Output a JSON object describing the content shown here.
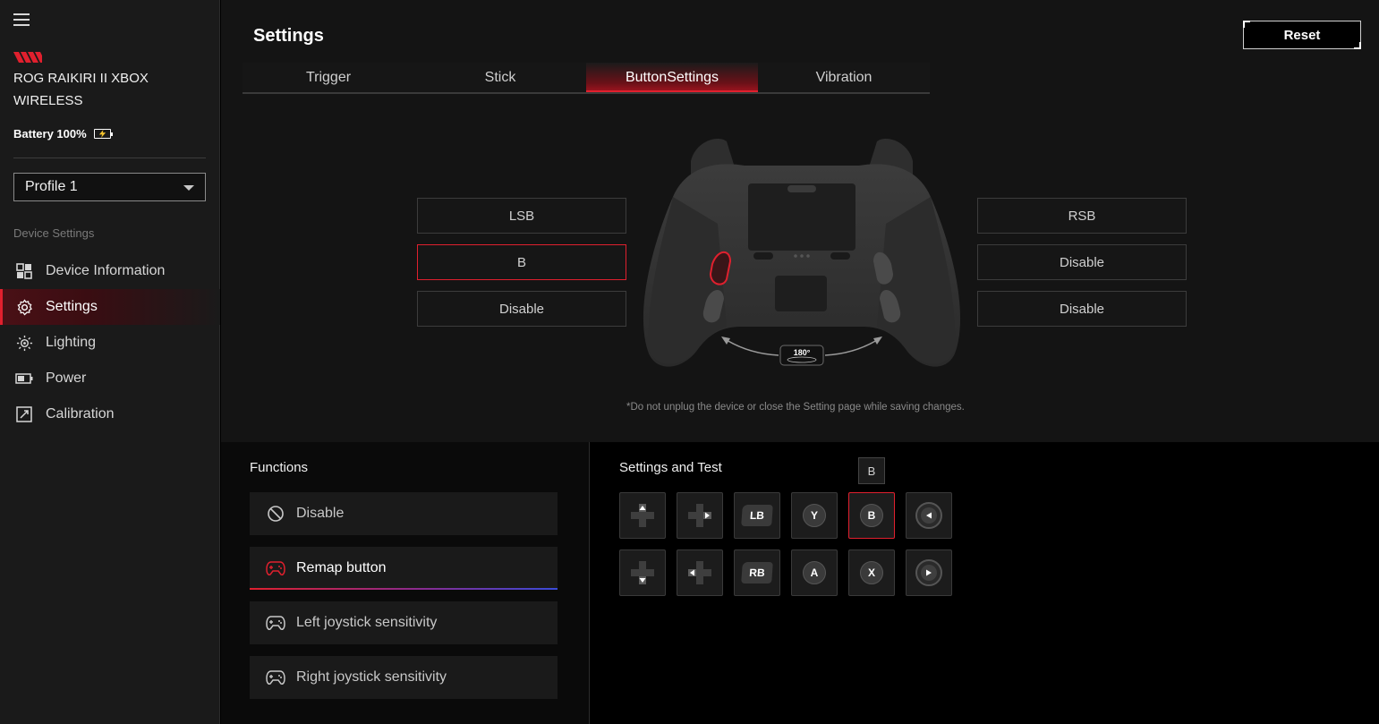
{
  "sidebar": {
    "device_name": "ROG RAIKIRI II XBOX WIRELESS",
    "battery": "Battery 100%",
    "profile": "Profile 1",
    "section_label": "Device Settings",
    "items": [
      {
        "label": "Device Information",
        "icon": "device-info-icon"
      },
      {
        "label": "Settings",
        "icon": "gear-icon",
        "active": true
      },
      {
        "label": "Lighting",
        "icon": "lighting-icon"
      },
      {
        "label": "Power",
        "icon": "battery-icon"
      },
      {
        "label": "Calibration",
        "icon": "calibration-icon"
      }
    ]
  },
  "header": {
    "title": "Settings",
    "reset_label": "Reset"
  },
  "tabs": [
    {
      "label": "Trigger"
    },
    {
      "label": "Stick"
    },
    {
      "label": "ButtonSettings",
      "active": true
    },
    {
      "label": "Vibration"
    }
  ],
  "mapping": {
    "left": [
      "LSB",
      "B",
      "Disable"
    ],
    "right": [
      "RSB",
      "Disable",
      "Disable"
    ],
    "selected": "left-1"
  },
  "controller": {
    "rotation_badge": "180°"
  },
  "save_note": "*Do not unplug the device or close the Setting page while saving changes.",
  "functions": {
    "title": "Functions",
    "items": [
      {
        "label": "Disable",
        "icon": "disable-icon"
      },
      {
        "label": "Remap button",
        "icon": "gamepad-icon",
        "active": true
      },
      {
        "label": "Left joystick sensitivity",
        "icon": "gamepad-icon"
      },
      {
        "label": "Right joystick sensitivity",
        "icon": "gamepad-icon"
      }
    ]
  },
  "test": {
    "title": "Settings and Test",
    "tooltip": "B",
    "keys": {
      "lb": "LB",
      "rb": "RB",
      "y": "Y",
      "a": "A",
      "b": "B",
      "x": "X"
    }
  },
  "colors": {
    "accent": "#e0202e",
    "background": "#141414",
    "sidebar": "#1a1a1a"
  }
}
